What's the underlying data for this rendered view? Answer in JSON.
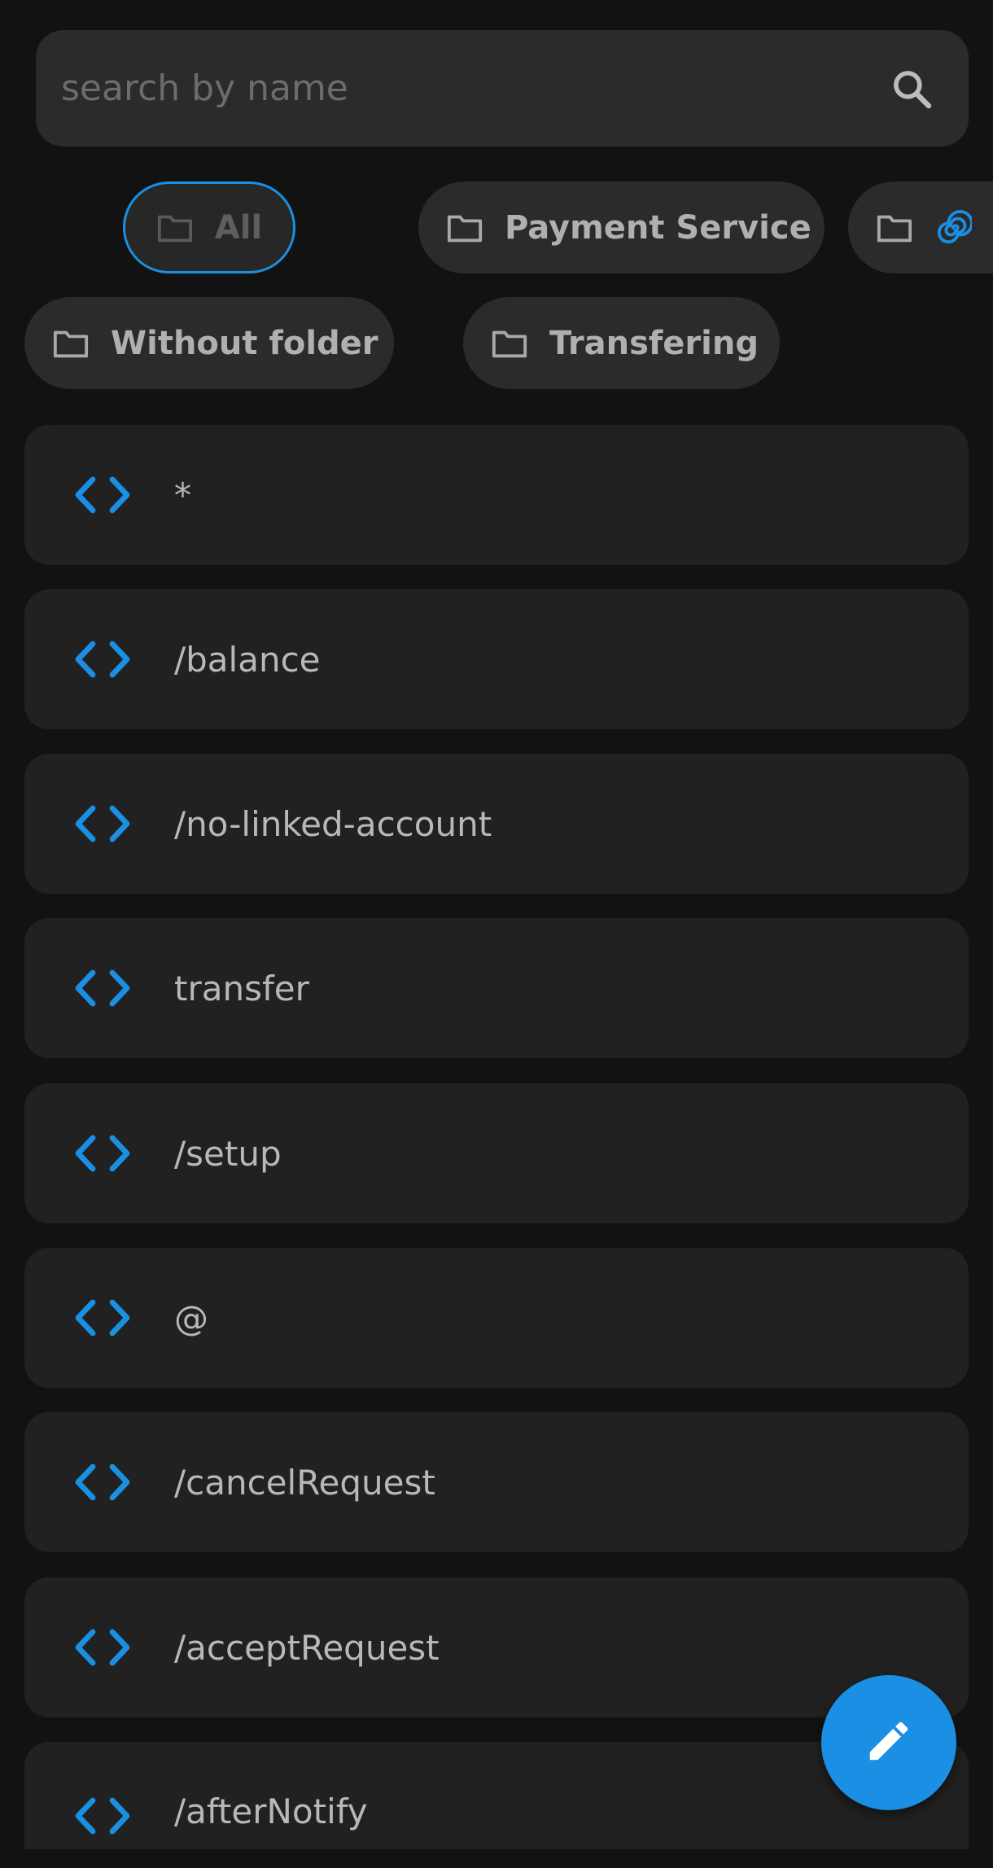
{
  "search": {
    "placeholder": "search by name",
    "icon": "search-icon"
  },
  "folders": [
    {
      "label": "All",
      "icon": "folder-icon",
      "active": true
    },
    {
      "label": "Payment Service",
      "icon": "folder-icon"
    },
    {
      "label": "",
      "icon": "folder-icon",
      "extra_icon": "spiral-icon"
    },
    {
      "label": "Without folder",
      "icon": "folder-icon"
    },
    {
      "label": "Transfering",
      "icon": "folder-icon"
    }
  ],
  "items": [
    {
      "label": "*",
      "icon": "code-icon"
    },
    {
      "label": "/balance",
      "icon": "code-icon"
    },
    {
      "label": "/no-linked-account",
      "icon": "code-icon"
    },
    {
      "label": "transfer",
      "icon": "code-icon"
    },
    {
      "label": "/setup",
      "icon": "code-icon"
    },
    {
      "label": "@",
      "icon": "code-icon"
    },
    {
      "label": "/cancelRequest",
      "icon": "code-icon"
    },
    {
      "label": "/acceptRequest",
      "icon": "code-icon"
    },
    {
      "label": "/afterNotify",
      "icon": "code-icon"
    }
  ],
  "fab": {
    "icon": "pencil-icon"
  },
  "colors": {
    "accent": "#1a8fe3",
    "background": "#121212",
    "card": "#212121",
    "chip": "#2b2b2b"
  }
}
